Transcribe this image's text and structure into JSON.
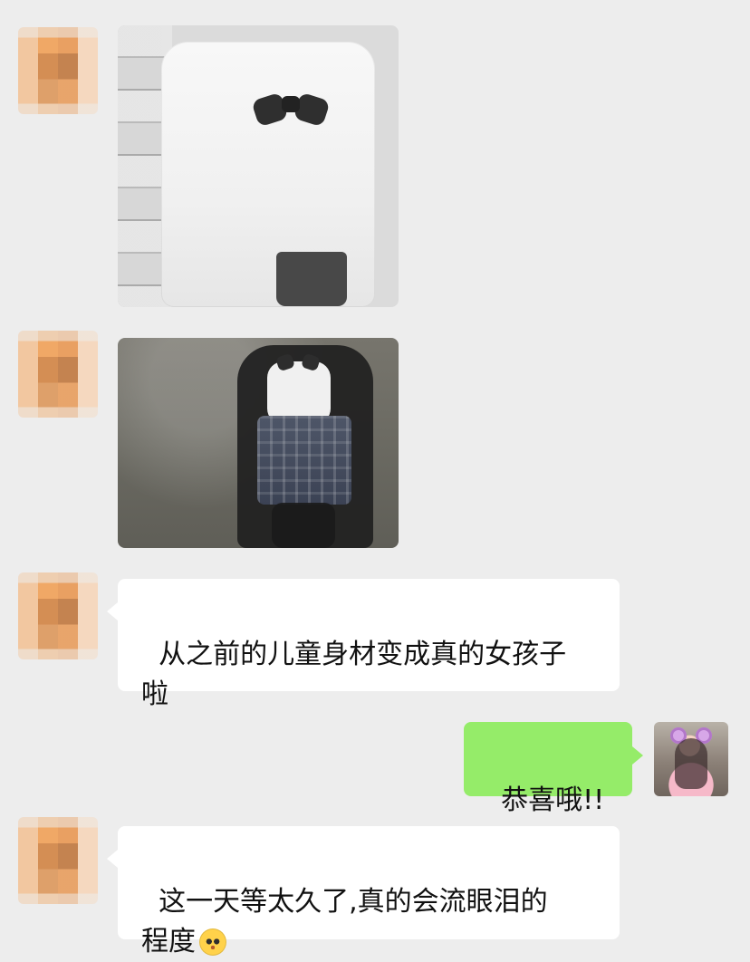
{
  "chat": {
    "messages": [
      {
        "type": "image",
        "sender": "other",
        "avatar": "pixelated-avatar",
        "image_label": "white shirt with black bow"
      },
      {
        "type": "image",
        "sender": "other",
        "avatar": "pixelated-avatar",
        "image_label": "uniform with plaid skirt and black coat"
      },
      {
        "type": "text",
        "sender": "other",
        "avatar": "pixelated-avatar",
        "text": "从之前的儿童身材变成真的女孩子\n啦"
      },
      {
        "type": "text",
        "sender": "self",
        "avatar": "user-avatar",
        "text": "恭喜哦!!"
      },
      {
        "type": "text",
        "sender": "other",
        "avatar": "pixelated-avatar",
        "text": "这一天等太久了,真的会流眼泪的\n程度",
        "emoji": "pleading-face-emoji"
      }
    ]
  },
  "colors": {
    "background": "#ededed",
    "bubble_left": "#ffffff",
    "bubble_right": "#95ec69"
  }
}
